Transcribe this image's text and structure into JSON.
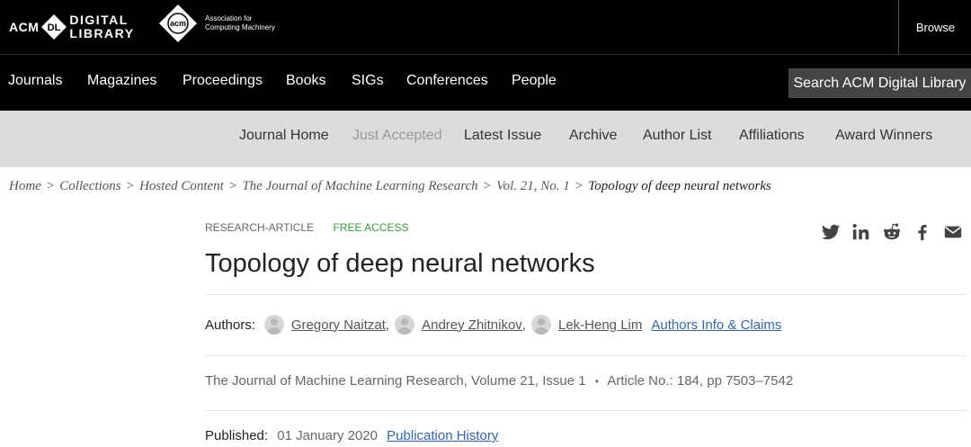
{
  "header": {
    "dl_logo": {
      "acm": "ACM",
      "badge": "DL",
      "line1": "DIGITAL",
      "line2": "LIBRARY"
    },
    "acm_logo": {
      "mark": "acm",
      "text": "Association for Computing Machinery"
    },
    "browse_label": "Browse"
  },
  "main_nav": {
    "items": [
      "Journals",
      "Magazines",
      "Proceedings",
      "Books",
      "SIGs",
      "Conferences",
      "People"
    ],
    "search_label": "Search ACM Digital Library"
  },
  "journal_nav": {
    "items": [
      "Journal Home",
      "Just Accepted",
      "Latest Issue",
      "Archive",
      "Author List",
      "Affiliations",
      "Award Winners"
    ]
  },
  "breadcrumb": {
    "items": [
      "Home",
      "Collections",
      "Hosted Content",
      "The Journal of Machine Learning Research",
      "Vol. 21, No. 1"
    ],
    "current": "Topology of deep neural networks",
    "separator": ">"
  },
  "article": {
    "type_label": "RESEARCH-ARTICLE",
    "access_label": "FREE ACCESS",
    "title": "Topology of deep neural networks",
    "authors_label": "Authors:",
    "authors": [
      "Gregory Naitzat",
      "Andrey Zhitnikov",
      "Lek-Heng Lim"
    ],
    "authors_info_link": "Authors Info & Claims",
    "citation": {
      "journal": "The Journal of Machine Learning Research",
      "volume": "Volume 21",
      "issue": "Issue 1",
      "bullet": "•",
      "article_no": "Article No.: 184",
      "pages": "pp 7503–7542"
    },
    "published_label": "Published:",
    "published_date": "01 January 2020",
    "publication_history_link": "Publication History"
  },
  "share_icons": [
    "twitter-icon",
    "linkedin-icon",
    "reddit-icon",
    "facebook-icon",
    "email-icon"
  ],
  "colors": {
    "accent_link": "#3366aa",
    "free_access": "#3a9a3a",
    "nav_bg": "#000000",
    "subnav_bg": "#dcdcdc"
  }
}
